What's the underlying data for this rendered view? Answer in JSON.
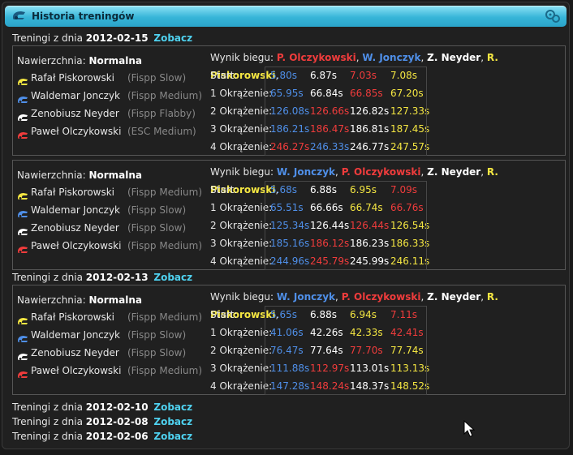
{
  "window": {
    "title": "Historia treningów"
  },
  "labels": {
    "day_prefix": "Treningi z dnia",
    "view_link": "Zobacz",
    "surface_prefix": "Nawierzchnia:",
    "result_prefix": "Wynik biegu:"
  },
  "colors": {
    "red": "#f03c3c",
    "blue": "#4f8fe8",
    "white": "#ffffff",
    "yellow": "#f4e642",
    "accent": "#4fd2f0"
  },
  "days": [
    {
      "date": "2012-02-15",
      "sessions": [
        {
          "surface": "Normalna",
          "drivers": [
            {
              "name": "Rafał Piskorowski",
              "vehicle": "(Fispp Slow)",
              "color": "yellow"
            },
            {
              "name": "Waldemar Jonczyk",
              "vehicle": "(Fispp Medium)",
              "color": "blue"
            },
            {
              "name": "Zenobiusz Neyder",
              "vehicle": "(Fispp Flabby)",
              "color": "white"
            },
            {
              "name": "Paweł Olczykowski",
              "vehicle": "(ESC Medium)",
              "color": "red"
            }
          ],
          "result_order": [
            {
              "name": "P. Olczykowski",
              "color": "red"
            },
            {
              "name": "W. Jonczyk",
              "color": "blue"
            },
            {
              "name": "Z. Neyder",
              "color": "white"
            },
            {
              "name": "R. Piskorowski",
              "color": "yellow"
            }
          ],
          "laps": [
            {
              "label": "Start:",
              "times": [
                "5.80s",
                "6.87s",
                "7.03s",
                "7.08s"
              ],
              "colors": [
                "blue",
                "white",
                "red",
                "yellow"
              ]
            },
            {
              "label": "1 Okrążenie:",
              "times": [
                "65.95s",
                "66.84s",
                "66.85s",
                "67.20s"
              ],
              "colors": [
                "blue",
                "white",
                "red",
                "yellow"
              ]
            },
            {
              "label": "2 Okrążenie:",
              "times": [
                "126.08s",
                "126.66s",
                "126.82s",
                "127.33s"
              ],
              "colors": [
                "blue",
                "red",
                "white",
                "yellow"
              ]
            },
            {
              "label": "3 Okrążenie:",
              "times": [
                "186.21s",
                "186.47s",
                "186.81s",
                "187.45s"
              ],
              "colors": [
                "blue",
                "red",
                "white",
                "yellow"
              ]
            },
            {
              "label": "4 Okrążenie:",
              "times": [
                "246.27s",
                "246.33s",
                "246.77s",
                "247.57s"
              ],
              "colors": [
                "red",
                "blue",
                "white",
                "yellow"
              ]
            }
          ]
        },
        {
          "surface": "Normalna",
          "drivers": [
            {
              "name": "Rafał Piskorowski",
              "vehicle": "(Fispp Medium)",
              "color": "yellow"
            },
            {
              "name": "Waldemar Jonczyk",
              "vehicle": "(Fispp Slow)",
              "color": "blue"
            },
            {
              "name": "Zenobiusz Neyder",
              "vehicle": "(Fispp Slow)",
              "color": "white"
            },
            {
              "name": "Paweł Olczykowski",
              "vehicle": "(Fispp Medium)",
              "color": "red"
            }
          ],
          "result_order": [
            {
              "name": "W. Jonczyk",
              "color": "blue"
            },
            {
              "name": "P. Olczykowski",
              "color": "red"
            },
            {
              "name": "Z. Neyder",
              "color": "white"
            },
            {
              "name": "R. Piskorowski",
              "color": "yellow"
            }
          ],
          "laps": [
            {
              "label": "Start:",
              "times": [
                "5.68s",
                "6.88s",
                "6.95s",
                "7.09s"
              ],
              "colors": [
                "blue",
                "white",
                "yellow",
                "red"
              ]
            },
            {
              "label": "1 Okrążenie:",
              "times": [
                "65.51s",
                "66.66s",
                "66.74s",
                "66.76s"
              ],
              "colors": [
                "blue",
                "white",
                "yellow",
                "red"
              ]
            },
            {
              "label": "2 Okrążenie:",
              "times": [
                "125.34s",
                "126.44s",
                "126.44s",
                "126.54s"
              ],
              "colors": [
                "blue",
                "white",
                "red",
                "yellow"
              ]
            },
            {
              "label": "3 Okrążenie:",
              "times": [
                "185.16s",
                "186.12s",
                "186.23s",
                "186.33s"
              ],
              "colors": [
                "blue",
                "red",
                "white",
                "yellow"
              ]
            },
            {
              "label": "4 Okrążenie:",
              "times": [
                "244.96s",
                "245.79s",
                "245.99s",
                "246.11s"
              ],
              "colors": [
                "blue",
                "red",
                "white",
                "yellow"
              ]
            }
          ]
        }
      ]
    },
    {
      "date": "2012-02-13",
      "sessions": [
        {
          "surface": "Normalna",
          "drivers": [
            {
              "name": "Rafał Piskorowski",
              "vehicle": "(Fispp Medium)",
              "color": "yellow"
            },
            {
              "name": "Waldemar Jonczyk",
              "vehicle": "(Fispp Slow)",
              "color": "blue"
            },
            {
              "name": "Zenobiusz Neyder",
              "vehicle": "(Fispp Slow)",
              "color": "white"
            },
            {
              "name": "Paweł Olczykowski",
              "vehicle": "(Fispp Medium)",
              "color": "red"
            }
          ],
          "result_order": [
            {
              "name": "W. Jonczyk",
              "color": "blue"
            },
            {
              "name": "P. Olczykowski",
              "color": "red"
            },
            {
              "name": "Z. Neyder",
              "color": "white"
            },
            {
              "name": "R. Piskorowski",
              "color": "yellow"
            }
          ],
          "laps": [
            {
              "label": "Start:",
              "times": [
                "5.65s",
                "6.88s",
                "6.94s",
                "7.11s"
              ],
              "colors": [
                "blue",
                "white",
                "yellow",
                "red"
              ]
            },
            {
              "label": "1 Okrążenie:",
              "times": [
                "41.06s",
                "42.26s",
                "42.33s",
                "42.41s"
              ],
              "colors": [
                "blue",
                "white",
                "yellow",
                "red"
              ]
            },
            {
              "label": "2 Okrążenie:",
              "times": [
                "76.47s",
                "77.64s",
                "77.70s",
                "77.74s"
              ],
              "colors": [
                "blue",
                "white",
                "red",
                "yellow"
              ]
            },
            {
              "label": "3 Okrążenie:",
              "times": [
                "111.88s",
                "112.97s",
                "113.01s",
                "113.13s"
              ],
              "colors": [
                "blue",
                "red",
                "white",
                "yellow"
              ]
            },
            {
              "label": "4 Okrążenie:",
              "times": [
                "147.28s",
                "148.24s",
                "148.37s",
                "148.52s"
              ],
              "colors": [
                "blue",
                "red",
                "white",
                "yellow"
              ]
            }
          ]
        }
      ]
    }
  ],
  "other_days": [
    "2012-02-10",
    "2012-02-08",
    "2012-02-06"
  ]
}
